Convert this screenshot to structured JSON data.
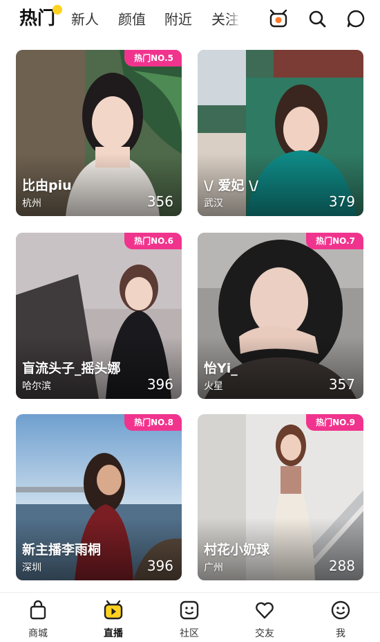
{
  "header": {
    "tabs": [
      {
        "label": "热门",
        "active": true
      },
      {
        "label": "新人"
      },
      {
        "label": "颜值"
      },
      {
        "label": "附近"
      },
      {
        "label": "关注"
      }
    ],
    "active_dot_color": "#ffd21f",
    "icons": [
      "tv-icon",
      "search-icon",
      "message-icon"
    ]
  },
  "badge_color": "#f0348d",
  "cards": [
    {
      "badge": "热门NO.5",
      "name": "比由piu",
      "city": "杭州",
      "count": "356"
    },
    {
      "badge": "",
      "name": "\\/ 爱妃 \\/",
      "city": "武汉",
      "count": "379"
    },
    {
      "badge": "热门NO.6",
      "name": "盲流头子_摇头娜",
      "city": "哈尔滨",
      "count": "396"
    },
    {
      "badge": "热门NO.7",
      "name": "怡Yi_",
      "city": "火星",
      "count": "357"
    },
    {
      "badge": "热门NO.8",
      "name": "新主播李雨桐",
      "city": "深圳",
      "count": "396"
    },
    {
      "badge": "热门NO.9",
      "name": "村花小奶球",
      "city": "广州",
      "count": "288"
    }
  ],
  "bottom_nav": [
    {
      "label": "商城",
      "icon": "shopping-bag-icon"
    },
    {
      "label": "直播",
      "icon": "live-tv-icon",
      "active": true,
      "active_color": "#ffd21f"
    },
    {
      "label": "社区",
      "icon": "smiley-square-icon"
    },
    {
      "label": "交友",
      "icon": "heart-icon"
    },
    {
      "label": "我",
      "icon": "smiley-circle-icon"
    }
  ]
}
